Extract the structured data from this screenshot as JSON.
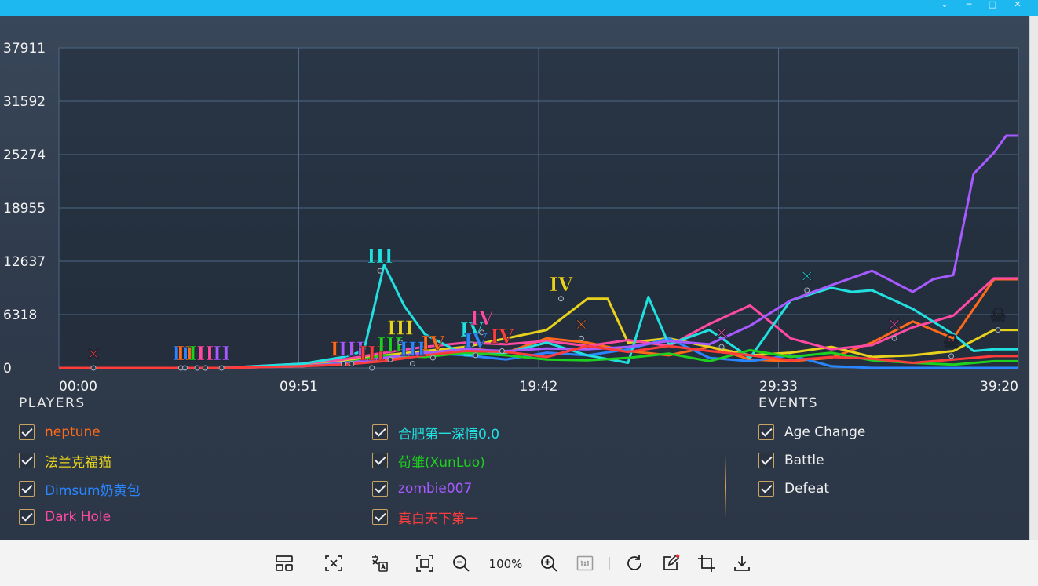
{
  "window": {
    "buttons": [
      "⌄",
      "─",
      "□",
      "✕"
    ]
  },
  "chart_data": {
    "type": "line",
    "yticks": [
      "37911",
      "31592",
      "25274",
      "18955",
      "12637",
      "6318",
      "0"
    ],
    "xticks": [
      "00:00",
      "09:51",
      "19:42",
      "29:33",
      "39:20"
    ],
    "xlim": [
      0,
      2360
    ],
    "ylim": [
      0,
      37911
    ],
    "grid": true,
    "series": [
      {
        "name": "neptune",
        "color": "#ff6a1a",
        "x": [
          0,
          200,
          400,
          600,
          700,
          800,
          900,
          1000,
          1100,
          1200,
          1300,
          1400,
          1500,
          1600,
          1700,
          1800,
          1900,
          2000,
          2100,
          2200,
          2300,
          2360
        ],
        "values": [
          0,
          0,
          0,
          200,
          500,
          1000,
          1500,
          2400,
          1800,
          3500,
          3000,
          2000,
          1500,
          2500,
          1000,
          800,
          1200,
          3000,
          5500,
          3500,
          10500,
          10500
        ]
      },
      {
        "name": "法兰克福猫",
        "color": "#e8d21c",
        "x": [
          0,
          200,
          400,
          600,
          700,
          800,
          900,
          1000,
          1100,
          1200,
          1300,
          1350,
          1400,
          1500,
          1600,
          1700,
          1800,
          1900,
          2000,
          2100,
          2200,
          2300,
          2360
        ],
        "values": [
          0,
          0,
          0,
          300,
          900,
          1500,
          2000,
          2500,
          3500,
          4500,
          8200,
          8200,
          3000,
          3500,
          2500,
          1500,
          1800,
          2500,
          1300,
          1500,
          2000,
          4500,
          4500
        ]
      },
      {
        "name": "Dimsum奶黄包",
        "color": "#2a86ff",
        "x": [
          0,
          200,
          400,
          600,
          700,
          800,
          900,
          1000,
          1100,
          1200,
          1300,
          1400,
          1500,
          1600,
          1700,
          1800,
          1900,
          2000,
          2100,
          2200,
          2300,
          2360
        ],
        "values": [
          0,
          0,
          0,
          200,
          600,
          1200,
          1800,
          1500,
          1000,
          1800,
          1500,
          2200,
          3500,
          1200,
          800,
          1500,
          200,
          0,
          0,
          0,
          0,
          0
        ]
      },
      {
        "name": "Dark Hole",
        "color": "#ff4aa3",
        "x": [
          0,
          200,
          400,
          600,
          700,
          800,
          900,
          1000,
          1100,
          1200,
          1300,
          1400,
          1500,
          1600,
          1700,
          1800,
          1900,
          2000,
          2100,
          2200,
          2300,
          2360
        ],
        "values": [
          0,
          0,
          0,
          500,
          1000,
          1800,
          2500,
          3000,
          2800,
          3200,
          2600,
          3300,
          2600,
          5200,
          7400,
          3500,
          2200,
          2700,
          4800,
          6200,
          10600,
          10600
        ]
      },
      {
        "name": "合肥第一深情0.0",
        "color": "#22e0e0",
        "x": [
          0,
          200,
          400,
          600,
          700,
          750,
          800,
          850,
          900,
          1000,
          1100,
          1200,
          1300,
          1400,
          1450,
          1500,
          1600,
          1700,
          1800,
          1900,
          1950,
          2000,
          2100,
          2200,
          2250,
          2300,
          2360
        ],
        "values": [
          0,
          0,
          0,
          500,
          1300,
          2000,
          12200,
          7300,
          4000,
          1500,
          1800,
          3000,
          1500,
          600,
          8400,
          2800,
          4500,
          1200,
          8000,
          9500,
          9000,
          9200,
          7000,
          4000,
          2000,
          2200,
          2200
        ]
      },
      {
        "name": "荀雏(XunLuo)",
        "color": "#1ed11e",
        "x": [
          0,
          200,
          400,
          600,
          700,
          800,
          900,
          1000,
          1100,
          1200,
          1300,
          1400,
          1500,
          1600,
          1700,
          1800,
          1900,
          2000,
          2100,
          2200,
          2300,
          2360
        ],
        "values": [
          0,
          0,
          0,
          200,
          500,
          1500,
          1300,
          1800,
          1500,
          1000,
          900,
          1200,
          1700,
          800,
          2100,
          1300,
          1800,
          900,
          600,
          400,
          800,
          800
        ]
      },
      {
        "name": "zombie007",
        "color": "#a65aff",
        "x": [
          0,
          200,
          400,
          600,
          700,
          800,
          900,
          1000,
          1100,
          1200,
          1300,
          1400,
          1500,
          1600,
          1700,
          1800,
          1900,
          2000,
          2100,
          2150,
          2200,
          2250,
          2300,
          2330,
          2360
        ],
        "values": [
          0,
          0,
          0,
          200,
          500,
          1200,
          1800,
          2200,
          2000,
          2300,
          2200,
          2500,
          3200,
          2800,
          5000,
          8000,
          9800,
          11500,
          9000,
          10500,
          11000,
          23000,
          25500,
          27500,
          27500
        ]
      },
      {
        "name": "真白天下第一",
        "color": "#ff3c3c",
        "x": [
          0,
          200,
          400,
          600,
          700,
          800,
          900,
          1000,
          1100,
          1200,
          1300,
          1400,
          1500,
          1600,
          1700,
          1800,
          1900,
          2000,
          2100,
          2200,
          2300,
          2360
        ],
        "values": [
          0,
          0,
          0,
          200,
          400,
          800,
          1500,
          2000,
          1900,
          1300,
          2600,
          1900,
          2600,
          2000,
          1500,
          900,
          1300,
          1100,
          600,
          1000,
          1400,
          1400
        ]
      }
    ],
    "markers": [
      {
        "glyph": "✕",
        "color": "#ff3c3c",
        "x": 85,
        "y": 0
      },
      {
        "glyph": "II",
        "color": "#2a86ff",
        "x": 300,
        "y": 0
      },
      {
        "glyph": "II",
        "color": "#ff6a1a",
        "x": 310,
        "y": 0
      },
      {
        "glyph": "II",
        "color": "#1ed11e",
        "x": 340,
        "y": 0
      },
      {
        "glyph": "II",
        "color": "#ff4aa3",
        "x": 360,
        "y": 0
      },
      {
        "glyph": "II",
        "color": "#a65aff",
        "x": 400,
        "y": 0
      },
      {
        "glyph": "III",
        "color": "#ff6a1a",
        "x": 700,
        "y": 500
      },
      {
        "glyph": "III",
        "color": "#a65aff",
        "x": 720,
        "y": 500
      },
      {
        "glyph": "III",
        "color": "#ff3c3c",
        "x": 770,
        "y": 0
      },
      {
        "glyph": "III",
        "color": "#22e0e0",
        "x": 790,
        "y": 11500
      },
      {
        "glyph": "III",
        "color": "#1ed11e",
        "x": 815,
        "y": 1000
      },
      {
        "glyph": "III",
        "color": "#e8d21c",
        "x": 840,
        "y": 3000
      },
      {
        "glyph": "III",
        "color": "#2a86ff",
        "x": 870,
        "y": 500
      },
      {
        "glyph": "IV",
        "color": "#ff6a1a",
        "x": 920,
        "y": 1200
      },
      {
        "glyph": "IV",
        "color": "#22e0e0",
        "x": 1015,
        "y": 2800
      },
      {
        "glyph": "IV",
        "color": "#ff4aa3",
        "x": 1040,
        "y": 4200
      },
      {
        "glyph": "IV",
        "color": "#2a86ff",
        "x": 1025,
        "y": 1500
      },
      {
        "glyph": "IV",
        "color": "#ff3c3c",
        "x": 1090,
        "y": 2000
      },
      {
        "glyph": "IV",
        "color": "#e8d21c",
        "x": 1235,
        "y": 8200
      },
      {
        "glyph": "✕",
        "color": "#ff6a1a",
        "x": 1285,
        "y": 3500
      },
      {
        "glyph": "✕",
        "color": "#ff4aa3",
        "x": 1630,
        "y": 2500
      },
      {
        "glyph": "✕",
        "color": "#22e0e0",
        "x": 1840,
        "y": 9200
      },
      {
        "glyph": "✕",
        "color": "#ff4aa3",
        "x": 2055,
        "y": 3500
      },
      {
        "glyph": "☠",
        "color": "#ff3c3c",
        "x": 2195,
        "y": 1400
      },
      {
        "glyph": "☠",
        "color": "#e8d21c",
        "x": 2310,
        "y": 4500
      }
    ]
  },
  "legend": {
    "players_title": "PLAYERS",
    "players": [
      {
        "name": "neptune",
        "color": "#ff6a1a"
      },
      {
        "name": "法兰克福猫",
        "color": "#e8d21c"
      },
      {
        "name": "Dimsum奶黄包",
        "color": "#2a86ff"
      },
      {
        "name": "Dark Hole",
        "color": "#ff4aa3"
      },
      {
        "name": "合肥第一深情0.0",
        "color": "#22e0e0"
      },
      {
        "name": "荀雏(XunLuo)",
        "color": "#1ed11e"
      },
      {
        "name": "zombie007",
        "color": "#a65aff"
      },
      {
        "name": "真白天下第一",
        "color": "#ff3c3c"
      }
    ],
    "events_title": "EVENTS",
    "events": [
      {
        "name": "Age Change",
        "color": "#f0f0f0"
      },
      {
        "name": "Battle",
        "color": "#f0f0f0"
      },
      {
        "name": "Defeat",
        "color": "#f0f0f0"
      }
    ]
  },
  "toolbar": {
    "zoom": "100%",
    "buttons": [
      "layout-icon",
      "ocr-select-icon",
      "translate-icon",
      "fit-screen-icon",
      "zoom-out-icon",
      "zoom-in-icon",
      "actual-size-icon",
      "rotate-icon",
      "edit-icon",
      "crop-icon",
      "download-icon"
    ]
  }
}
